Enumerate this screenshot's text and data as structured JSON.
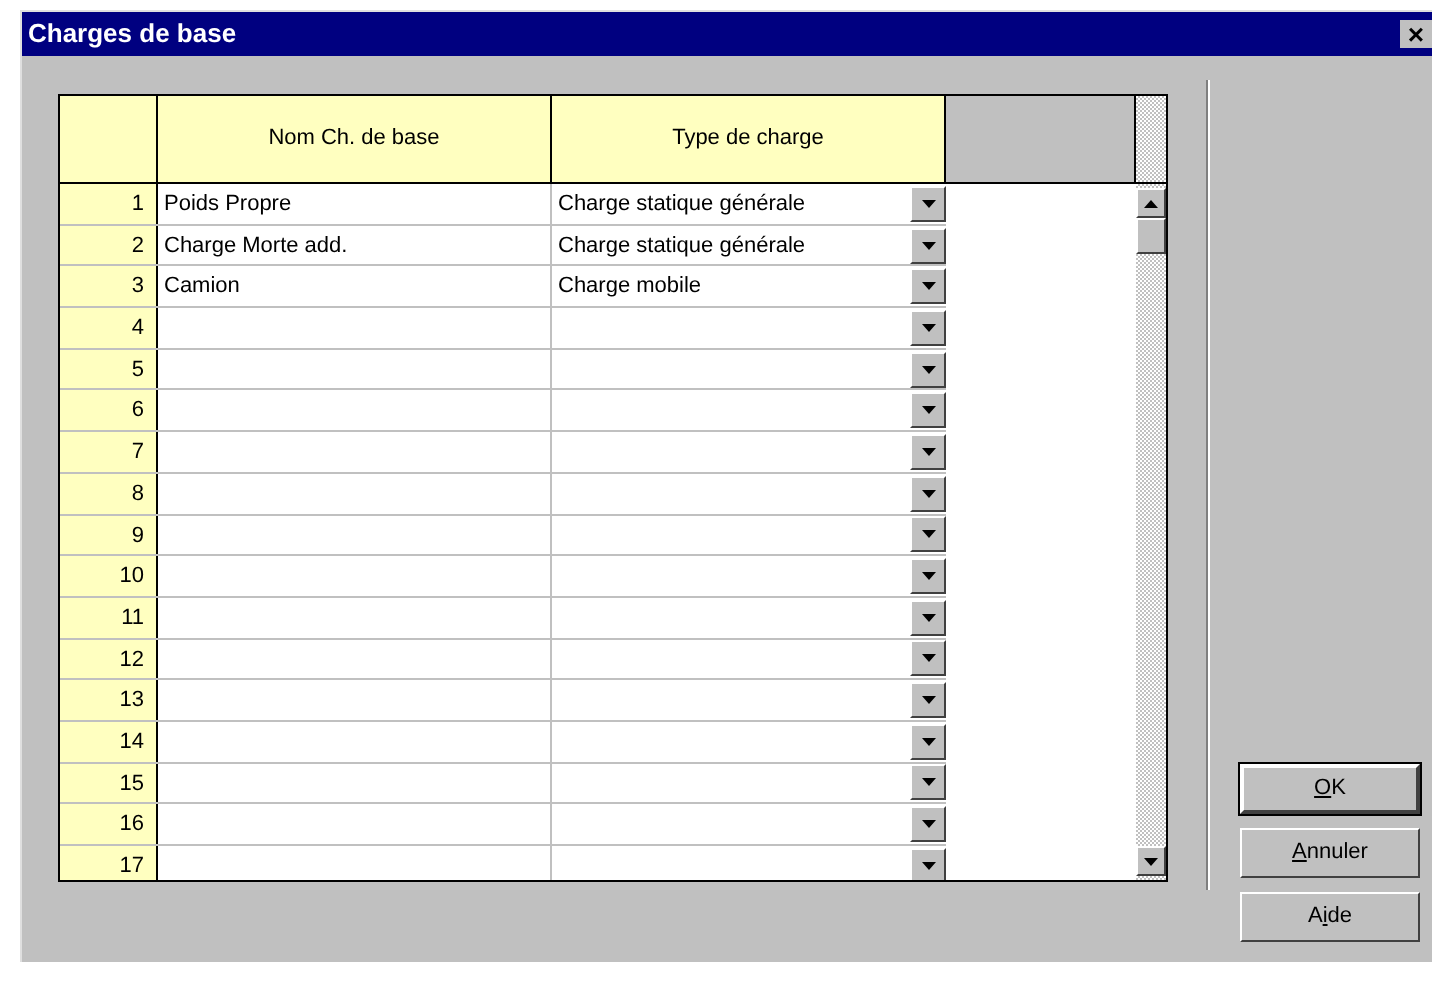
{
  "window": {
    "title": "Charges de base",
    "close": "×"
  },
  "table": {
    "columns": [
      "Nom Ch. de base",
      "Type de charge"
    ],
    "rows": [
      {
        "number": "1",
        "name": "Poids Propre",
        "type": "Charge statique générale"
      },
      {
        "number": "2",
        "name": "Charge Morte add.",
        "type": "Charge statique générale"
      },
      {
        "number": "3",
        "name": "Camion",
        "type": "Charge mobile"
      },
      {
        "number": "4"
      },
      {
        "number": "5"
      },
      {
        "number": "6"
      },
      {
        "number": "7"
      },
      {
        "number": "8"
      },
      {
        "number": "9"
      },
      {
        "number": "10"
      },
      {
        "number": "11"
      },
      {
        "number": "12"
      },
      {
        "number": "13"
      },
      {
        "number": "14"
      },
      {
        "number": "15"
      },
      {
        "number": "16"
      },
      {
        "number": "17"
      }
    ]
  },
  "buttons": [
    {
      "key": "O",
      "after": "K",
      "default": true
    },
    {
      "key": "A",
      "after": "nnuler",
      "default": false
    },
    {
      "before": "A",
      "key": "i",
      "after": "de",
      "default": false
    }
  ]
}
